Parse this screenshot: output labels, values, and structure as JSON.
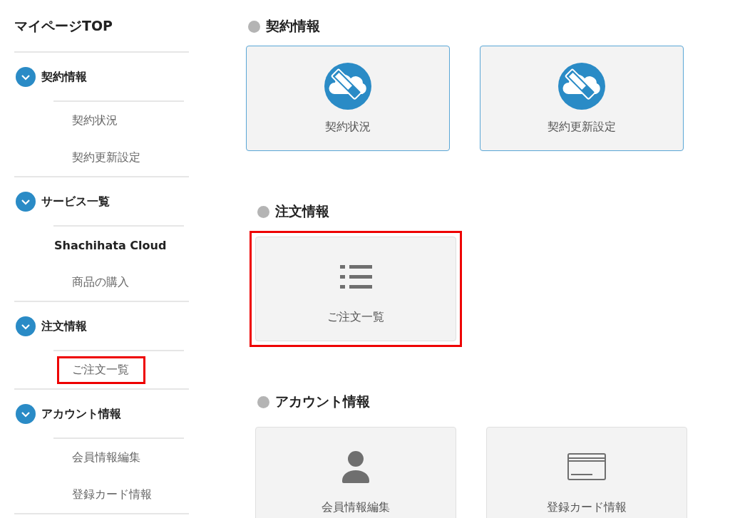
{
  "sidebar": {
    "title": "マイページTOP",
    "groups": [
      {
        "label": "契約情報",
        "expanded": true,
        "items": [
          {
            "label": "契約状況",
            "kind": "link",
            "highlighted": false
          },
          {
            "label": "契約更新設定",
            "kind": "link",
            "highlighted": false
          }
        ]
      },
      {
        "label": "サービス一覧",
        "expanded": true,
        "items": [
          {
            "label": "Shachihata Cloud",
            "kind": "heading",
            "highlighted": false
          },
          {
            "label": "商品の購入",
            "kind": "link",
            "highlighted": false
          }
        ]
      },
      {
        "label": "注文情報",
        "expanded": true,
        "items": [
          {
            "label": "ご注文一覧",
            "kind": "link",
            "highlighted": true
          }
        ]
      },
      {
        "label": "アカウント情報",
        "expanded": true,
        "items": [
          {
            "label": "会員情報編集",
            "kind": "link",
            "highlighted": false
          },
          {
            "label": "登録カード情報",
            "kind": "link",
            "highlighted": false
          }
        ]
      }
    ]
  },
  "sections": [
    {
      "heading": "契約情報",
      "bordered": true,
      "cards": [
        {
          "label": "契約状況",
          "kind": "cloud",
          "highlighted": false
        },
        {
          "label": "契約更新設定",
          "kind": "cloud",
          "highlighted": false
        }
      ]
    },
    {
      "heading": "注文情報",
      "bordered": false,
      "cards": [
        {
          "label": "ご注文一覧",
          "kind": "list",
          "highlighted": true
        }
      ]
    },
    {
      "heading": "アカウント情報",
      "bordered": false,
      "cards": [
        {
          "label": "会員情報編集",
          "kind": "person",
          "highlighted": false
        },
        {
          "label": "登録カード情報",
          "kind": "card",
          "highlighted": false
        }
      ]
    }
  ]
}
